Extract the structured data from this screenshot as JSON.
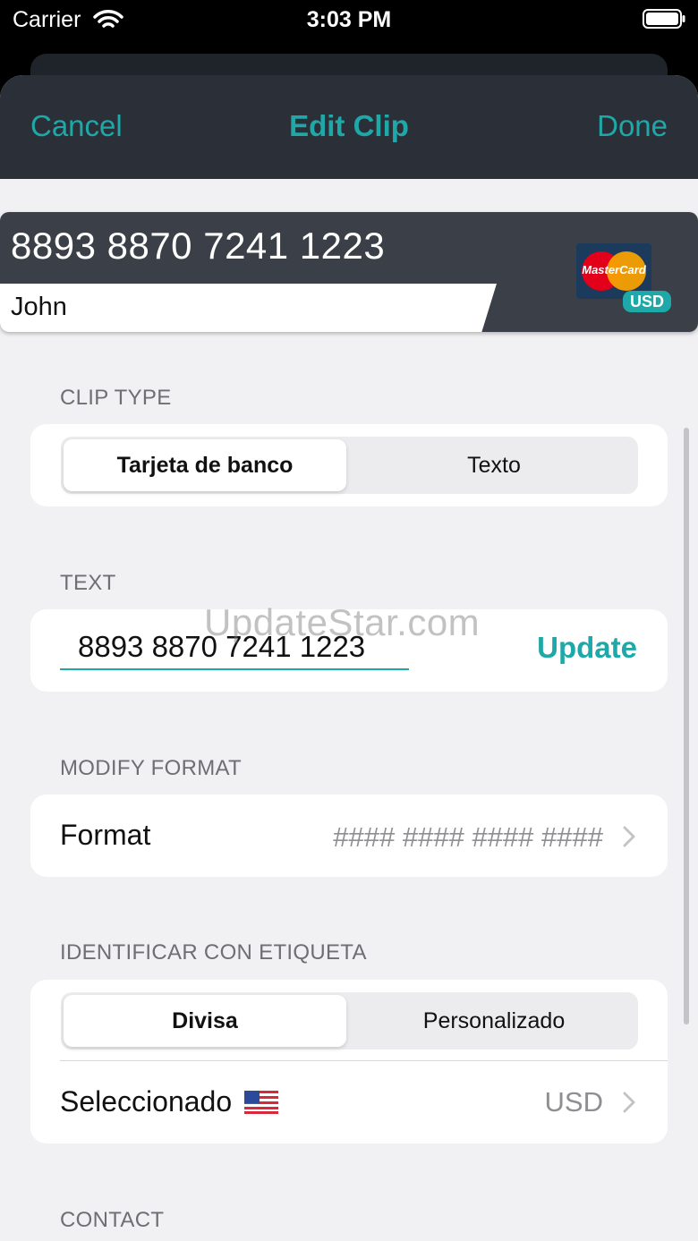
{
  "status_bar": {
    "carrier": "Carrier",
    "time": "3:03 PM"
  },
  "nav": {
    "cancel_label": "Cancel",
    "title": "Edit Clip",
    "done_label": "Done"
  },
  "card": {
    "number": "8893 8870 7241 1223",
    "name": "John",
    "brand_logo_text": "MasterCard",
    "currency_badge": "USD"
  },
  "sections": {
    "clip_type": {
      "header": "CLIP TYPE",
      "options": [
        "Tarjeta de banco",
        "Texto"
      ],
      "selected_index": 0
    },
    "text": {
      "header": "TEXT",
      "value": "8893 8870 7241 1223",
      "update_label": "Update"
    },
    "modify_format": {
      "header": "MODIFY FORMAT",
      "label": "Format",
      "value": "#### #### #### ####"
    },
    "tag": {
      "header": "IDENTIFICAR CON ETIQUETA",
      "options": [
        "Divisa",
        "Personalizado"
      ],
      "selected_index": 0,
      "selected_label": "Seleccionado",
      "selected_value": "USD",
      "flag_icon": "us-flag-icon"
    },
    "contact": {
      "header": "CONTACT"
    }
  },
  "colors": {
    "accent": "#1fa8a8",
    "nav_bg": "#2b3038",
    "card_bg": "#3b4048",
    "background": "#f1f1f3"
  },
  "watermark": "UpdateStar.com"
}
